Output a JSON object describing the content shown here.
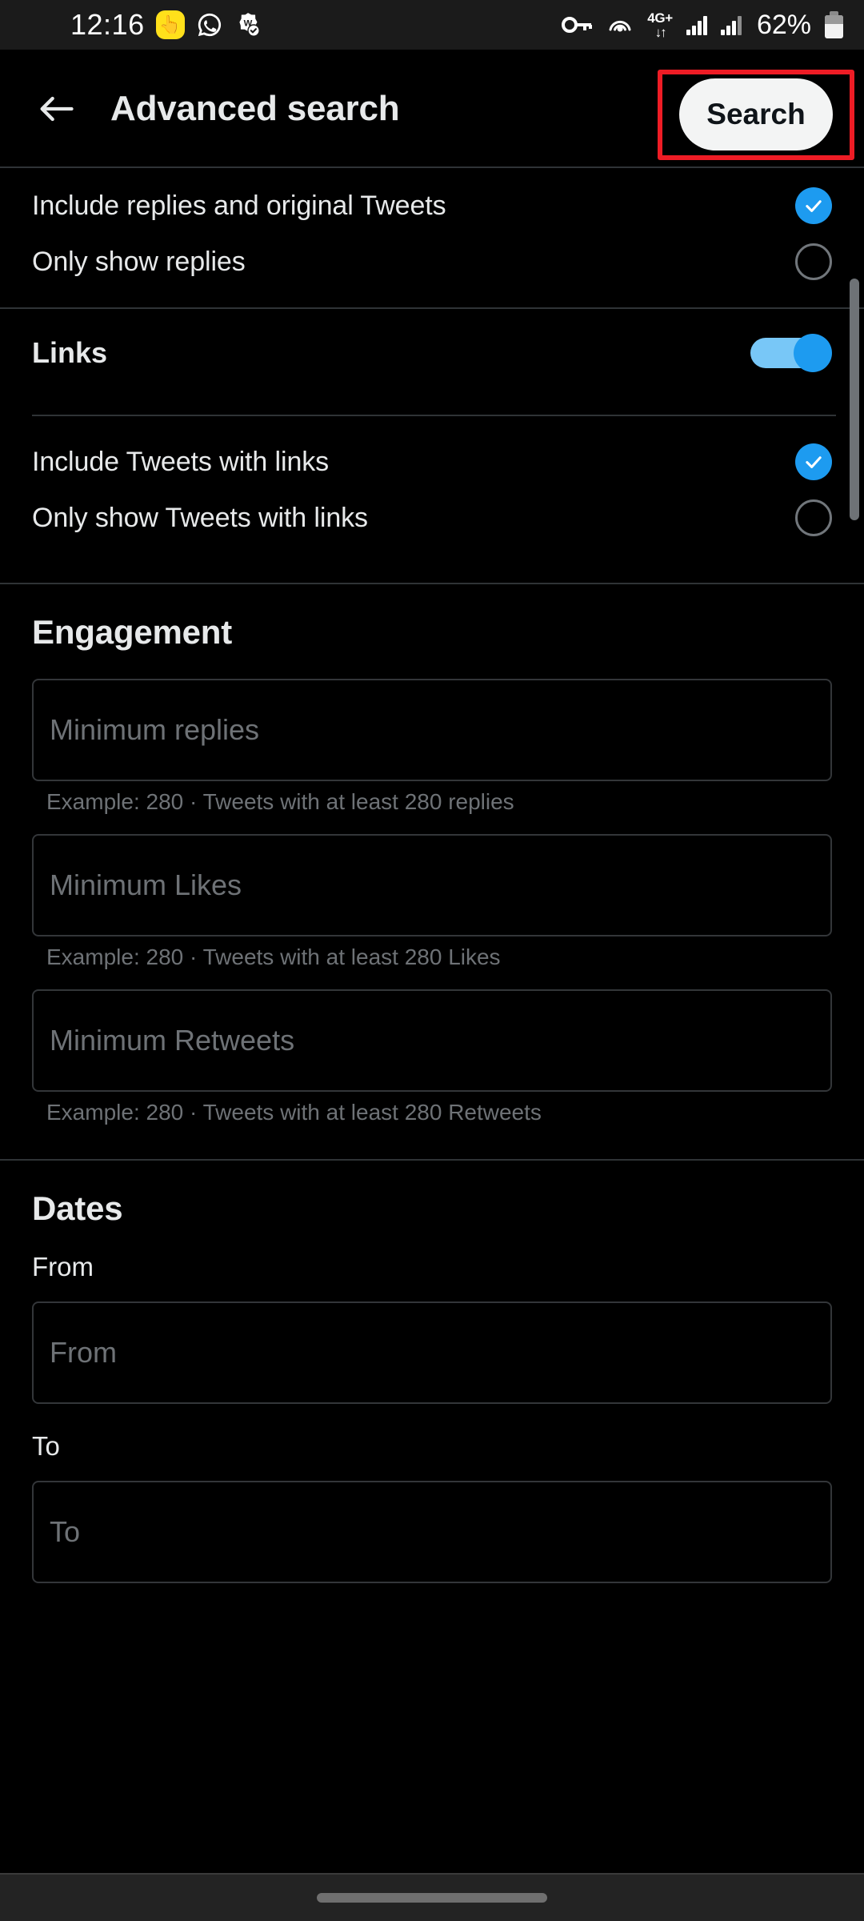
{
  "status_bar": {
    "time": "12:16",
    "icons_left": [
      "snapchat-icon",
      "whatsapp-icon",
      "verified-badge-icon"
    ],
    "network_label": "4G+",
    "network_arrows": "↓↑",
    "battery_percent": "62%",
    "icons_right": [
      "key-icon",
      "hotspot-icon",
      "network-4g-icon",
      "signal-bars-icon",
      "signal-bars-icon",
      "battery-icon"
    ]
  },
  "header": {
    "back_label": "Back",
    "title": "Advanced search",
    "search_button": "Search"
  },
  "colors": {
    "accent": "#1d9bf0",
    "toggle_track": "#78c7f7",
    "highlight_box": "#ee1c25",
    "background": "#000000",
    "text_primary": "#e7e9ea",
    "text_secondary": "#6e7276",
    "divider": "#2f3336"
  },
  "replies_section": {
    "options": [
      {
        "label": "Include replies and original Tweets",
        "selected": true
      },
      {
        "label": "Only show replies",
        "selected": false
      }
    ]
  },
  "links_section": {
    "title": "Links",
    "toggle_on": true,
    "options": [
      {
        "label": "Include Tweets with links",
        "selected": true
      },
      {
        "label": "Only show Tweets with links",
        "selected": false
      }
    ]
  },
  "engagement_section": {
    "title": "Engagement",
    "fields": [
      {
        "placeholder": "Minimum replies",
        "value": "",
        "helper": "Example: 280 · Tweets with at least 280 replies"
      },
      {
        "placeholder": "Minimum Likes",
        "value": "",
        "helper": "Example: 280 · Tweets with at least 280 Likes"
      },
      {
        "placeholder": "Minimum Retweets",
        "value": "",
        "helper": "Example: 280 · Tweets with at least 280 Retweets"
      }
    ]
  },
  "dates_section": {
    "title": "Dates",
    "fields": [
      {
        "label": "From",
        "placeholder": "From",
        "value": ""
      },
      {
        "label": "To",
        "placeholder": "To",
        "value": ""
      }
    ]
  },
  "nav_bar": {
    "gesture_pill": "home-gesture-pill"
  }
}
